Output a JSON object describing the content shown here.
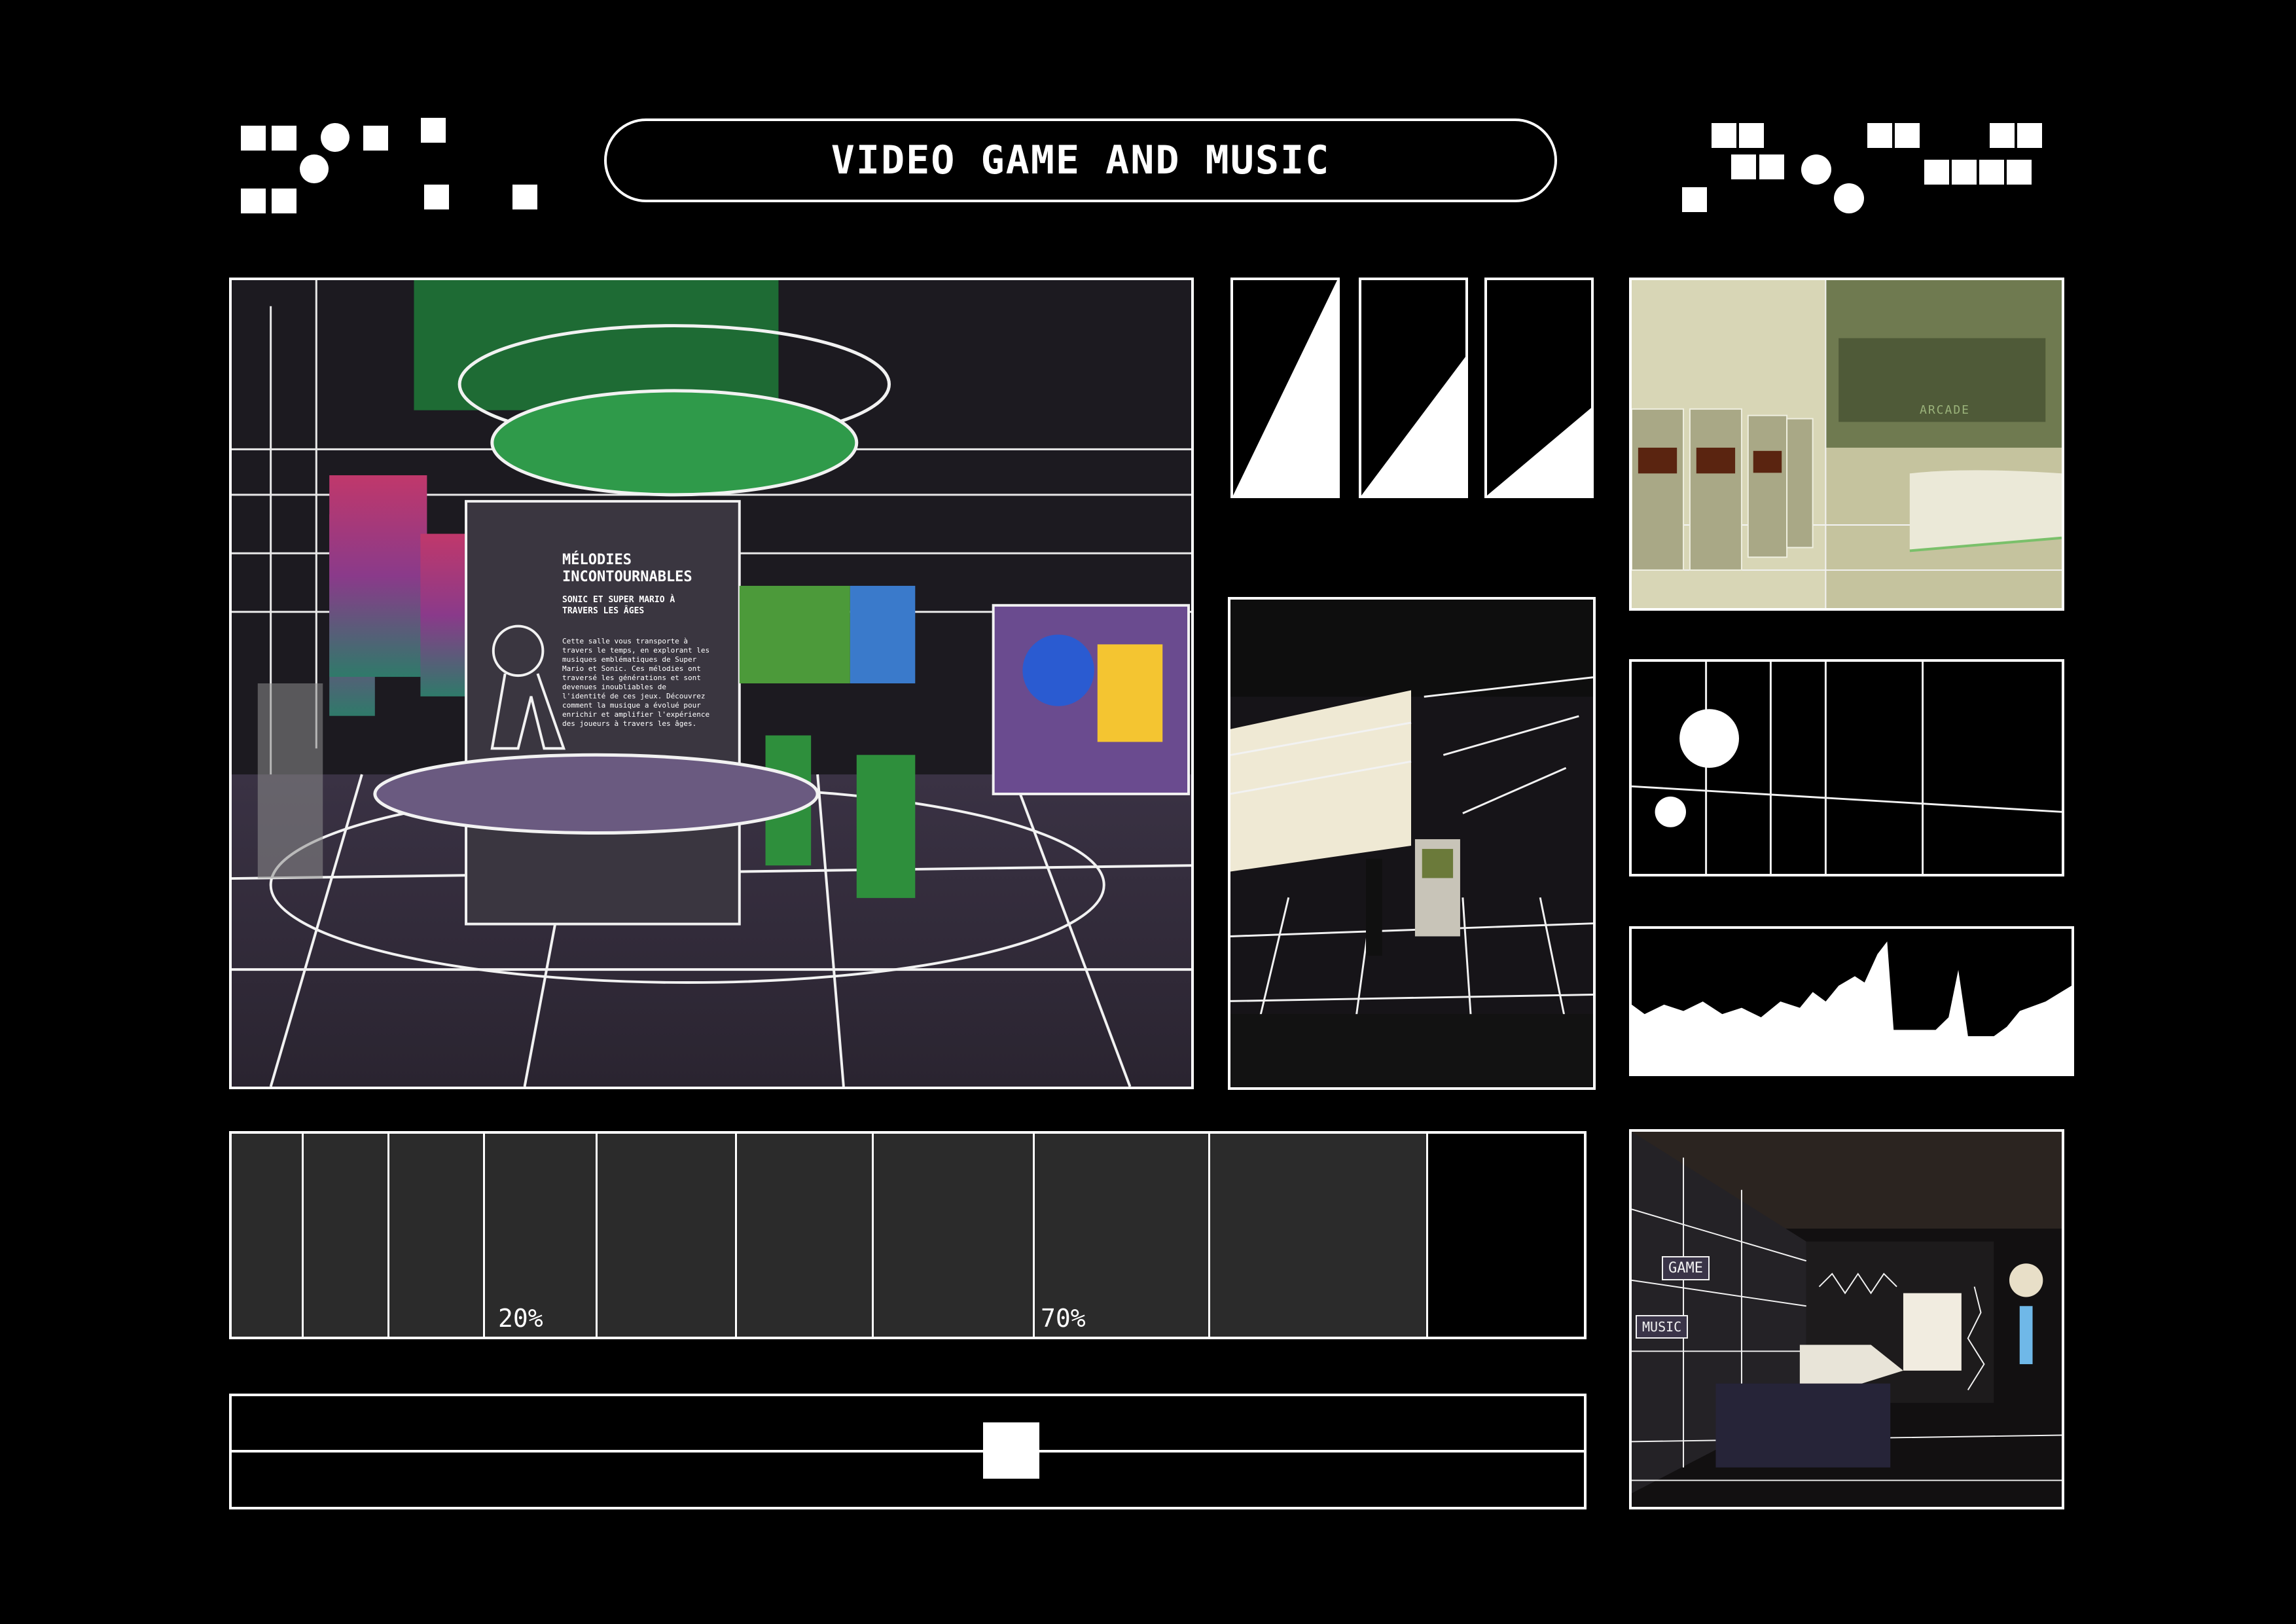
{
  "header": {
    "title": "VIDEO GAME AND MUSIC"
  },
  "main_render": {
    "sign_title": "MÉLODIES INCONTOURNABLES",
    "sign_subtitle": "SONIC ET SUPER MARIO À TRAVERS LES ÂGES",
    "sign_body": "Cette salle vous transporte à travers le temps, en explorant les musiques emblématiques de Super Mario et Sonic. Ces mélodies ont traversé les générations et sont devenues inoubliables de l'identité de ces jeux. Découvrez comment la musique a évolué pour enrichir et amplifier l'expérience des joueurs à travers les âges."
  },
  "arcade_render": {
    "sign": "ARCADE"
  },
  "room_render": {
    "wall_labels": [
      "GAME",
      "MUSIC"
    ]
  },
  "timeline": {
    "labels": [
      "20%",
      "70%"
    ]
  },
  "slider": {
    "value_percent": 58
  },
  "colors": {
    "background": "#000000",
    "foreground": "#ffffff",
    "segment_fill": "#2b2b2b",
    "accent_green": "#2e8f3c",
    "accent_purple": "#6a4b8f"
  }
}
